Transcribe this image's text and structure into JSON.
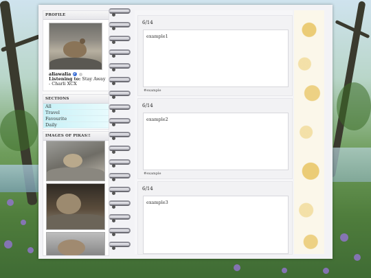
{
  "sidebar": {
    "profile": {
      "title": "PROFILE",
      "username": "aliawalia",
      "listening_label": "Listening to:",
      "listening_value": "Stay Away - Charli XCX"
    },
    "sections": {
      "title": "SECTIONS",
      "items": [
        "All",
        "Travel",
        "Favourite",
        "Daily"
      ]
    },
    "pikas": {
      "title": "IMAGES OF PIKAS!!"
    }
  },
  "entries": [
    {
      "date": "6/14",
      "text": "example1",
      "tag": "#example"
    },
    {
      "date": "6/14",
      "text": "example2",
      "tag": "#example"
    },
    {
      "date": "6/14",
      "text": "example3",
      "tag": ""
    }
  ],
  "colors": {
    "section_bg": "#c7f1f7",
    "lace": "#e8c462",
    "verify": "#3b6fd6"
  },
  "icons": [
    "verified-icon",
    "status-dot-icon"
  ]
}
